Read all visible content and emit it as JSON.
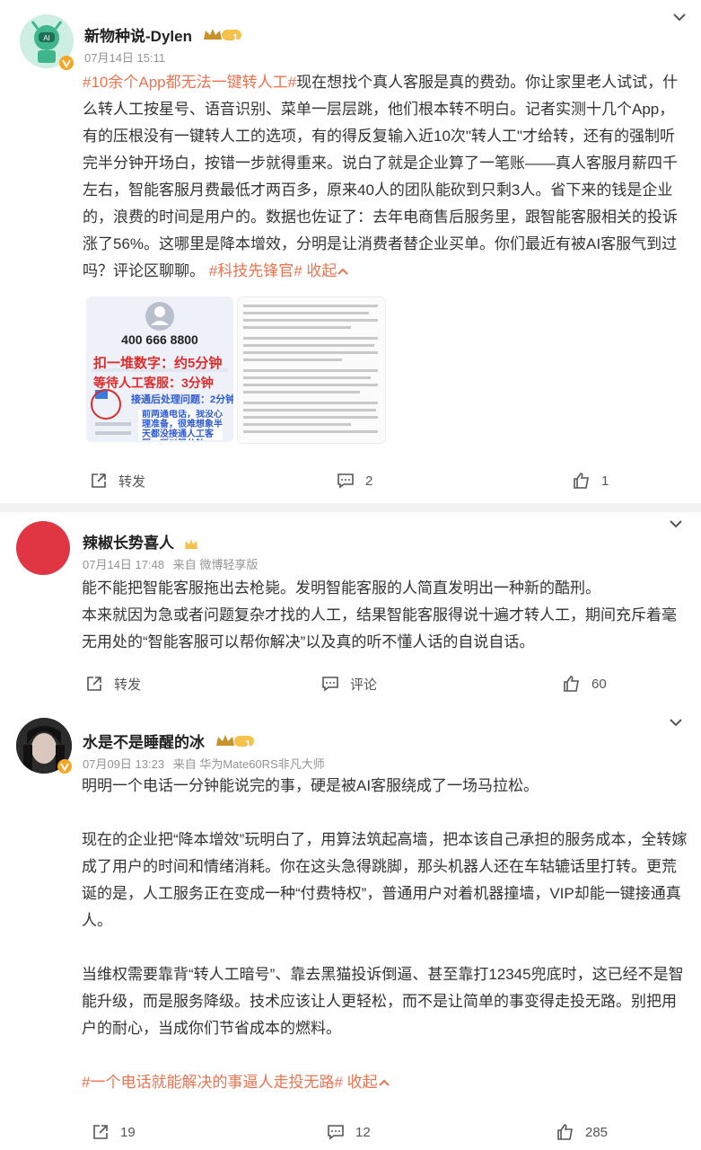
{
  "posts": [
    {
      "username": "新物种说-Dylen",
      "time": "07月14日 15:11",
      "level_badge": "1",
      "content_tag": "#10余个App都无法一键转人工#",
      "content": "现在想找个真人客服是真的费劲。你让家里老人试试，什么转人工按星号、语音识别、菜单一层层跳，他们根本转不明白。记者实测十几个App，有的压根没有一键转人工的选项，有的得反复输入近10次\"转人工\"才给转，还有的强制听完半分钟开场白，按错一步就得重来。说白了就是企业算了一笔账——真人客服月薪四千左右，智能客服月费最低才两百多，原来40人的团队能砍到只剩3人。省下来的钱是企业的，浪费的时间是用户的。数据也佐证了：去年电商售后服务里，跟智能客服相关的投诉涨了56%。这哪里是降本增效，分明是让消费者替企业买单。你们最近有被AI客服气到过吗？评论区聊聊。",
      "end_tag": "#科技先锋官#",
      "collapse": "收起",
      "images": {
        "phone_number": "400 666 8800",
        "line1": "扣一堆数字：约5分钟",
        "line2": "等待人工客服：3分钟",
        "line3": "接通后处理问题：2分钟",
        "line4": "前两通电话，我没心理准备，很难想象半天都没接通人工客服，所以器分钟"
      },
      "repost_label": "转发",
      "comment_count": "2",
      "like_count": "1"
    },
    {
      "username": "辣椒长势喜人",
      "time": "07月14日 17:48",
      "source": "来自 微博轻享版",
      "content_p1": "能不能把智能客服拖出去枪毙。发明智能客服的人简直发明出一种新的酷刑。",
      "content_p2": "本来就因为急或者问题复杂才找的人工，结果智能客服得说十遍才转人工，期间充斥着毫无用处的“智能客服可以帮你解决”以及真的听不懂人话的自说自话。",
      "repost_label": "转发",
      "comment_label": "评论",
      "like_count": "60"
    },
    {
      "username": "水是不是睡醒的冰",
      "time": "07月09日 13:23",
      "source": "来自 华为Mate60RS非凡大师",
      "level_badge": "1",
      "content_p1": "明明一个电话一分钟能说完的事，硬是被AI客服绕成了一场马拉松。",
      "content_p2": "现在的企业把“降本增效”玩明白了，用算法筑起高墙，把本该自己承担的服务成本，全转嫁成了用户的时间和情绪消耗。你在这头急得跳脚，那头机器人还在车轱辘话里打转。更荒诞的是，人工服务正在变成一种“付费特权”，普通用户对着机器撞墙，VIP却能一键接通真人。",
      "content_p3": "当维权需要靠背“转人工暗号”、靠去黑猫投诉倒逼、甚至靠打12345兜底时，这已经不是智能升级，而是服务降级。技术应该让人更轻松，而不是让简单的事变得走投无路。别把用户的耐心，当成你们节省成本的燃料。",
      "end_tag": "#一个电话就能解决的事逼人走投无路#",
      "collapse": "收起",
      "repost_count": "19",
      "comment_count": "12",
      "like_count": "285"
    }
  ],
  "colors": {
    "accent": "#eb7350",
    "meta": "#939393",
    "separator": "#f2f2f2"
  }
}
